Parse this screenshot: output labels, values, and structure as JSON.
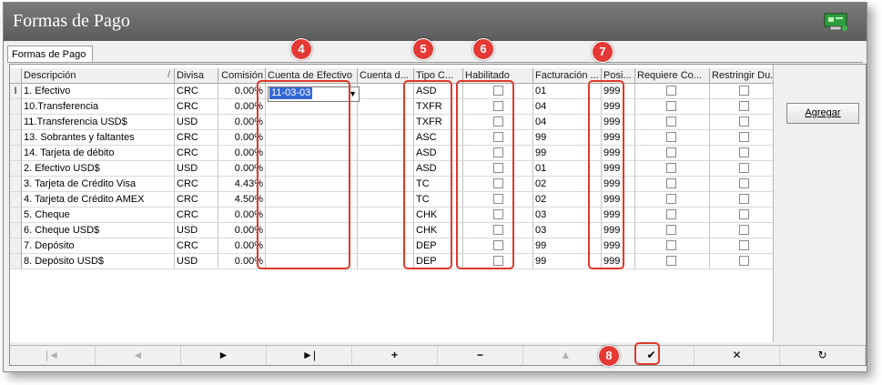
{
  "window": {
    "title": "Formas de Pago",
    "tab": "Formas de Pago"
  },
  "grid": {
    "headers": {
      "desc": "Descripción",
      "sort_indicator": "/",
      "div": "Divisa",
      "com": "Comisión",
      "cta": "Cuenta de Efectivo",
      "ctad": "Cuenta d...",
      "tipo": "Tipo C...",
      "hab": "Habilitado",
      "fac": "Facturación ...",
      "pos": "Posi...",
      "req": "Requiere Co...",
      "res": "Restringir Du..."
    },
    "row_indicator": "I",
    "editor_value": "11-03-03",
    "rows": [
      {
        "desc": "1. Efectivo",
        "div": "CRC",
        "com": "0.00%",
        "tipo": "ASD",
        "fac": "01",
        "pos": "999"
      },
      {
        "desc": "10.Transferencia",
        "div": "CRC",
        "com": "0.00%",
        "tipo": "TXFR",
        "fac": "04",
        "pos": "999"
      },
      {
        "desc": "11.Transferencia USD$",
        "div": "USD",
        "com": "0.00%",
        "tipo": "TXFR",
        "fac": "04",
        "pos": "999"
      },
      {
        "desc": "13. Sobrantes y faltantes",
        "div": "CRC",
        "com": "0.00%",
        "tipo": "ASC",
        "fac": "99",
        "pos": "999"
      },
      {
        "desc": "14. Tarjeta de débito",
        "div": "CRC",
        "com": "0.00%",
        "tipo": "ASD",
        "fac": "99",
        "pos": "999"
      },
      {
        "desc": "2. Efectivo USD$",
        "div": "USD",
        "com": "0.00%",
        "tipo": "ASD",
        "fac": "01",
        "pos": "999"
      },
      {
        "desc": "3. Tarjeta de Crédito Visa",
        "div": "CRC",
        "com": "4.43%",
        "tipo": "TC",
        "fac": "02",
        "pos": "999"
      },
      {
        "desc": "4. Tarjeta de Crédito AMEX",
        "div": "CRC",
        "com": "4.50%",
        "tipo": "TC",
        "fac": "02",
        "pos": "999"
      },
      {
        "desc": "5. Cheque",
        "div": "CRC",
        "com": "0.00%",
        "tipo": "CHK",
        "fac": "03",
        "pos": "999"
      },
      {
        "desc": "6. Cheque USD$",
        "div": "USD",
        "com": "0.00%",
        "tipo": "CHK",
        "fac": "03",
        "pos": "999"
      },
      {
        "desc": "7. Depósito",
        "div": "CRC",
        "com": "0.00%",
        "tipo": "DEP",
        "fac": "99",
        "pos": "999"
      },
      {
        "desc": "8. Depósito USD$",
        "div": "USD",
        "com": "0.00%",
        "tipo": "DEP",
        "fac": "99",
        "pos": "999"
      }
    ]
  },
  "buttons": {
    "agregar": "Agregar"
  },
  "navigator": [
    "|◄",
    "◄",
    "►",
    "►|",
    "+",
    "−",
    "▲",
    "✔",
    "✕",
    "↻"
  ],
  "callouts": [
    "4",
    "5",
    "6",
    "7",
    "8"
  ],
  "colors": {
    "titlebar": "#5c5c5c",
    "callout": "#e53935",
    "selection": "#3367d6"
  }
}
